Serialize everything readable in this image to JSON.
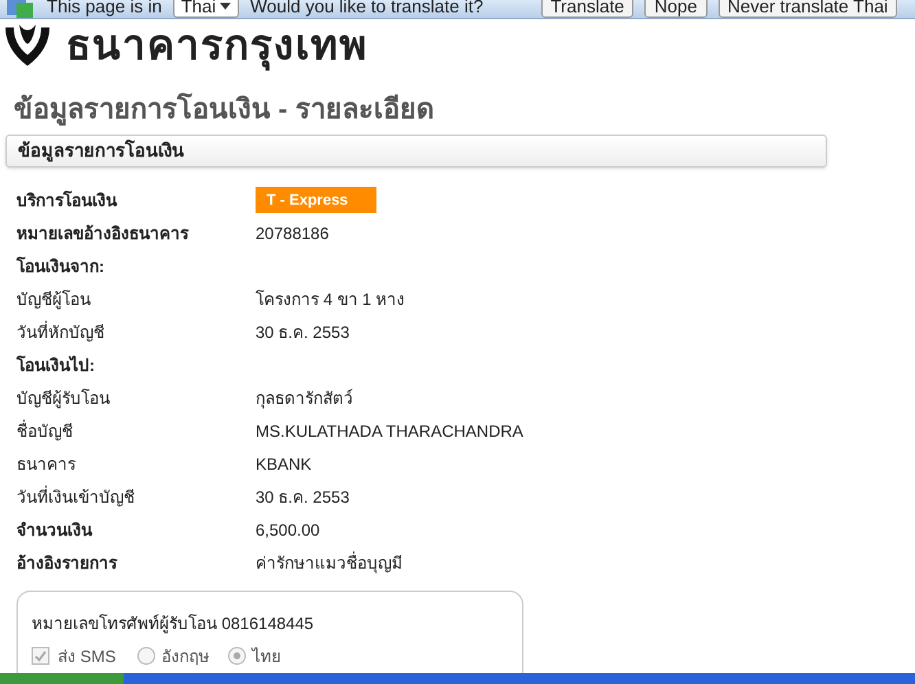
{
  "translate_bar": {
    "message": "This page is in",
    "language": "Thai",
    "question": "Would you like to translate it?",
    "buttons": [
      "Translate",
      "Nope",
      "Never translate Thai"
    ]
  },
  "logo": {
    "name": "ธนาคารกรุงเทพ"
  },
  "page_title": "ข้อมูลรายการโอนเงิน - รายละเอียด",
  "section_header": "ข้อมูลรายการโอนเงิน",
  "rows": [
    {
      "kind": "field",
      "label": "บริการโอนเงิน",
      "value": "T - Express",
      "badge": true,
      "bold": true
    },
    {
      "kind": "field",
      "label": "หมายเลขอ้างอิงธนาคาร",
      "value": "20788186",
      "badge": false,
      "bold": true
    },
    {
      "kind": "heading",
      "label": "โอนเงินจาก:"
    },
    {
      "kind": "field",
      "label": "บัญชีผู้โอน",
      "value": "โครงการ 4 ขา 1 หาง",
      "badge": false,
      "bold": false
    },
    {
      "kind": "field",
      "label": "วันที่หักบัญชี",
      "value": "30 ธ.ค. 2553",
      "badge": false,
      "bold": false
    },
    {
      "kind": "heading",
      "label": "โอนเงินไป:"
    },
    {
      "kind": "field",
      "label": "บัญชีผู้รับโอน",
      "value": "กุลธดารักสัตว์",
      "badge": false,
      "bold": false
    },
    {
      "kind": "field",
      "label": "ชื่อบัญชี",
      "value": "MS.KULATHADA THARACHANDRA",
      "badge": false,
      "bold": false
    },
    {
      "kind": "field",
      "label": "ธนาคาร",
      "value": "KBANK",
      "badge": false,
      "bold": false
    },
    {
      "kind": "field",
      "label": "วันที่เงินเข้าบัญชี",
      "value": "30 ธ.ค. 2553",
      "badge": false,
      "bold": false
    },
    {
      "kind": "field",
      "label": "จำนวนเงิน",
      "value": "6,500.00",
      "badge": false,
      "bold": true
    },
    {
      "kind": "field",
      "label": "อ้างอิงรายการ",
      "value": "ค่ารักษาแมวชื่อบุญมี",
      "badge": false,
      "bold": true
    }
  ],
  "sms_panel": {
    "phone_text": "หมายเลขโทรศัพท์ผู้รับโอน 0816148445",
    "send_sms": {
      "label": "ส่ง SMS",
      "checked": true,
      "disabled": true
    },
    "languages": [
      {
        "label": "อังกฤษ",
        "selected": false
      },
      {
        "label": "ไทย",
        "selected": true
      }
    ]
  }
}
